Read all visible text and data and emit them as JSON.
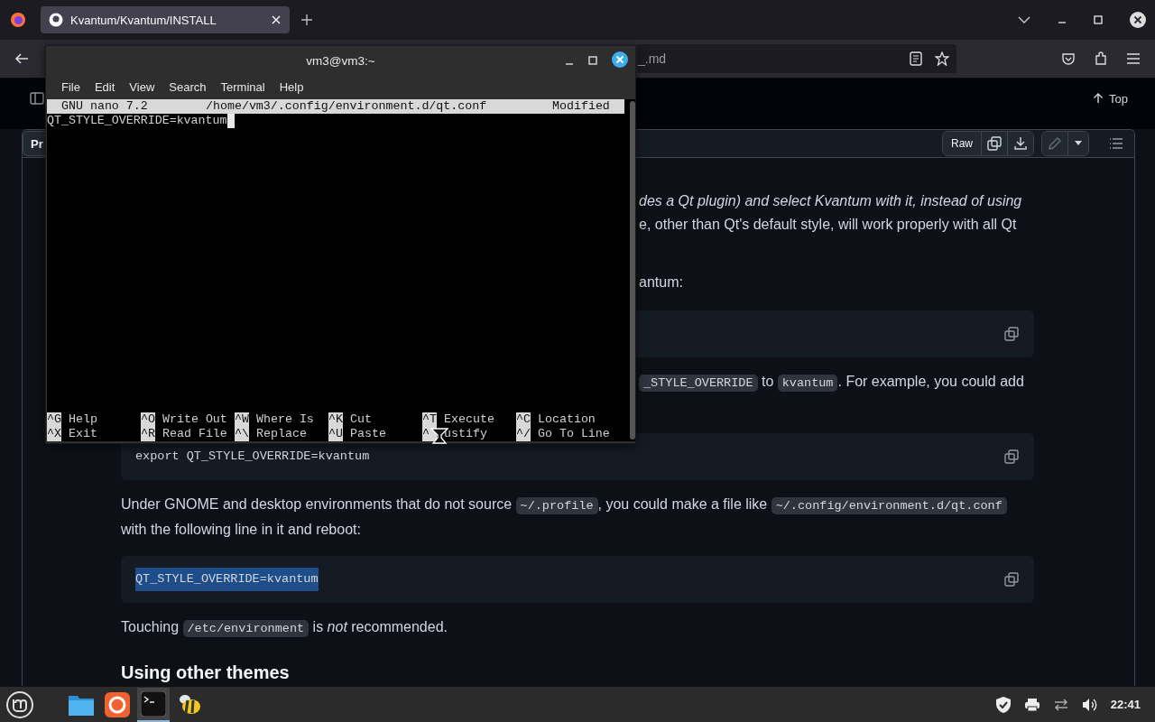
{
  "browser": {
    "tab": {
      "title": "Kvantum/Kvantum/INSTALL",
      "selected": true
    },
    "url": "_.md"
  },
  "github": {
    "top_link": "Top",
    "file_tab": "Pr",
    "raw_button": "Raw"
  },
  "article": [
    {
      "kind": "fragment",
      "segments": [
        {
          "kind": "italic",
          "text": "des a Qt plugin) and select Kvantum with it, instead of using"
        }
      ]
    },
    {
      "kind": "fragment",
      "segments": [
        {
          "kind": "text",
          "text": "e, other than Qt's default style, will work properly with all Qt"
        }
      ]
    },
    {
      "kind": "fragment",
      "segments": [
        {
          "kind": "text",
          "text": "antum:"
        }
      ]
    },
    {
      "kind": "code"
    },
    {
      "kind": "fragment",
      "segments": [
        {
          "kind": "code",
          "text": "_STYLE_OVERRIDE"
        },
        {
          "kind": "text",
          "text": " to "
        },
        {
          "kind": "code",
          "text": "kvantum"
        },
        {
          "kind": "text",
          "text": ". For example, you could add"
        }
      ]
    },
    {
      "kind": "code",
      "text": "export QT_STYLE_OVERRIDE=kvantum",
      "selected": false
    },
    {
      "kind": "paragraph",
      "segments": [
        {
          "kind": "text",
          "text": "Under GNOME and desktop environments that do not source "
        },
        {
          "kind": "code",
          "text": "~/.profile"
        },
        {
          "kind": "text",
          "text": ", you could make a file like "
        },
        {
          "kind": "code",
          "text": "~/.config/environment.d/qt.conf"
        },
        {
          "kind": "text",
          "text": " with the following line in it and reboot:"
        }
      ]
    },
    {
      "kind": "code",
      "text": "QT_STYLE_OVERRIDE=kvantum",
      "selected": true
    },
    {
      "kind": "paragraph",
      "segments": [
        {
          "kind": "text",
          "text": "Touching "
        },
        {
          "kind": "code",
          "text": "/etc/environment"
        },
        {
          "kind": "text",
          "text": " is *not* recommended."
        }
      ]
    },
    {
      "kind": "heading",
      "text": "Using other themes"
    }
  ],
  "terminal": {
    "title": "vm3@vm3:~",
    "menu": [
      "File",
      "Edit",
      "View",
      "Search",
      "Terminal",
      "Help"
    ],
    "nano": {
      "version": "GNU nano 7.2",
      "file": "/home/vm3/.config/environment.d/qt.conf",
      "status": "Modified",
      "lines": [
        "QT_STYLE_OVERRIDE=kvantum"
      ],
      "shortcuts": [
        [
          {
            "key": "^G",
            "label": "Help"
          },
          {
            "key": "^O",
            "label": "Write Out"
          },
          {
            "key": "^W",
            "label": "Where Is"
          },
          {
            "key": "^K",
            "label": "Cut"
          },
          {
            "key": "^T",
            "label": "Execute"
          },
          {
            "key": "^C",
            "label": "Location"
          }
        ],
        [
          {
            "key": "^X",
            "label": "Exit"
          },
          {
            "key": "^R",
            "label": "Read File"
          },
          {
            "key": "^\\",
            "label": "Replace"
          },
          {
            "key": "^U",
            "label": "Paste"
          },
          {
            "key": "^",
            "label": "ustify"
          },
          {
            "key": "^/",
            "label": "Go To Line"
          }
        ]
      ]
    }
  },
  "taskbar": {
    "apps": [
      {
        "kind": "files",
        "active": false
      },
      {
        "kind": "firefox",
        "active": false
      },
      {
        "kind": "terminal",
        "active": true
      },
      {
        "kind": "bee",
        "active": false
      }
    ],
    "clock": "22:41"
  }
}
